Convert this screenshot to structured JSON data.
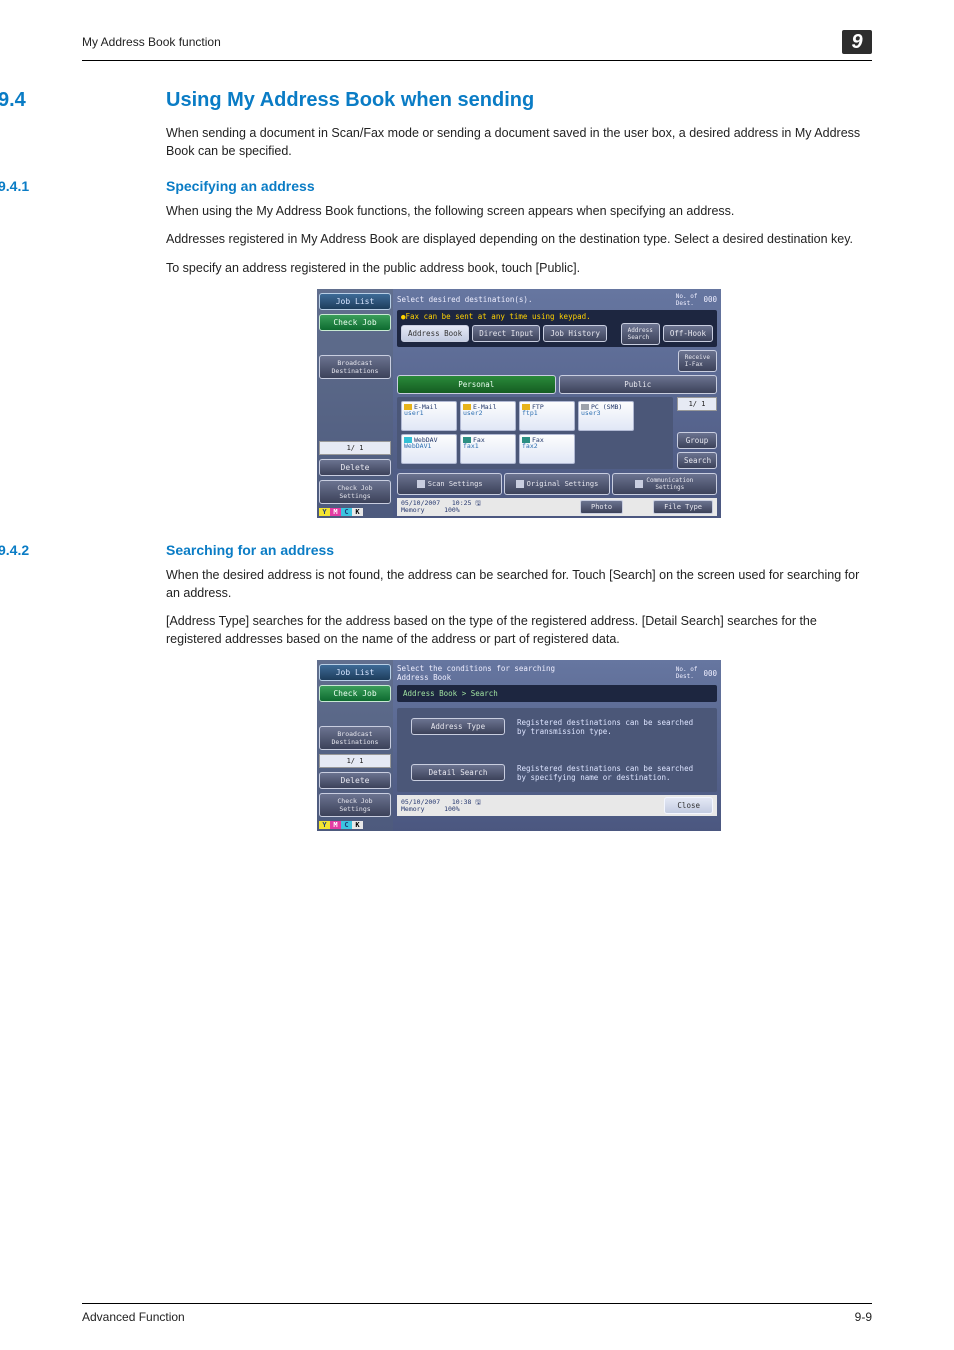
{
  "header": {
    "running_title": "My Address Book function",
    "chapter_badge": "9"
  },
  "sections": {
    "s94": {
      "num": "9.4",
      "title": "Using My Address Book when sending",
      "intro": "When sending a document in Scan/Fax mode or sending a document saved in the user box, a desired address in My Address Book can be specified."
    },
    "s941": {
      "num": "9.4.1",
      "title": "Specifying an address",
      "p1": "When using the My Address Book functions, the following screen appears when specifying an address.",
      "p2": "Addresses registered in My Address Book are displayed depending on the destination type. Select a desired destination key.",
      "p3": "To specify an address registered in the public address book, touch [Public]."
    },
    "s942": {
      "num": "9.4.2",
      "title": "Searching for an address",
      "p1": "When the desired address is not found, the address can be searched for. Touch [Search] on the screen used for searching for an address.",
      "p2": "[Address Type] searches for the address based on the type of the registered address. [Detail Search] searches for the registered addresses based on the name of the address or part of registered data."
    }
  },
  "screenshot1": {
    "left": {
      "job_list": "Job List",
      "check_job": "Check Job",
      "broadcast": "Broadcast\nDestinations",
      "page": "1/  1",
      "delete": "Delete",
      "check_settings": "Check Job\nSettings"
    },
    "head": {
      "prompt": "Select desired destination(s).",
      "note": "Fax can be sent at any time using keypad.",
      "dest_label": "No. of\nDest.",
      "dest_count": "000"
    },
    "tabs": {
      "address_book": "Address Book",
      "direct_input": "Direct Input",
      "job_history": "Job History",
      "address_search": "Address\nSearch",
      "off_hook": "Off-Hook",
      "receive_ifax": "Receive\nI-Fax"
    },
    "modebar": {
      "personal": "Personal",
      "public": "Public"
    },
    "cards": [
      {
        "type": "E-Mail",
        "name": "user1",
        "ic": "yellow"
      },
      {
        "type": "E-Mail",
        "name": "user2",
        "ic": "yellow"
      },
      {
        "type": "FTP",
        "name": "ftp1",
        "ic": "yellow"
      },
      {
        "type": "PC (SMB)",
        "name": "user3",
        "ic": "gray"
      },
      {
        "type": "WebDAV",
        "name": "WebDAV1",
        "ic": "blue"
      },
      {
        "type": "Fax",
        "name": "fax1",
        "ic": "teal"
      },
      {
        "type": "Fax",
        "name": "fax2",
        "ic": "teal"
      }
    ],
    "side": {
      "page": "1/  1",
      "group": "Group",
      "search": "Search"
    },
    "bottom": {
      "scan": "Scan Settings",
      "original": "Original Settings",
      "comm": "Communication\nSettings"
    },
    "footer": {
      "date": "05/10/2007",
      "time": "10:25",
      "mem_label": "Memory",
      "mem_value": "100%",
      "photo_tab": "Photo",
      "filetype_tab": "File Type"
    }
  },
  "screenshot2": {
    "left": {
      "job_list": "Job List",
      "check_job": "Check Job",
      "broadcast": "Broadcast\nDestinations",
      "page": "1/  1",
      "delete": "Delete",
      "check_settings": "Check Job\nSettings"
    },
    "head": {
      "prompt": "Select the conditions for searching\nAddress Book",
      "dest_label": "No. of\nDest.",
      "dest_count": "000"
    },
    "crumb": "Address Book > Search",
    "rows": {
      "address_type_btn": "Address Type",
      "address_type_hint": "Registered destinations can be searched\nby transmission type.",
      "detail_btn": "Detail Search",
      "detail_hint": "Registered destinations can be searched\nby specifying name or destination."
    },
    "close": "Close",
    "footer": {
      "date": "05/10/2007",
      "time": "10:38",
      "mem_label": "Memory",
      "mem_value": "100%"
    }
  },
  "pagefoot": {
    "left": "Advanced Function",
    "right": "9-9"
  }
}
